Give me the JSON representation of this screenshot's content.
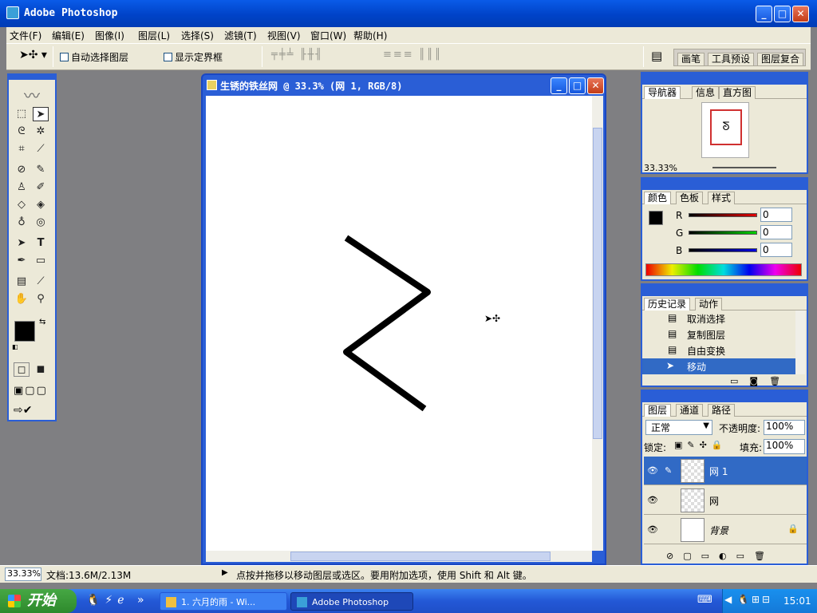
{
  "app": {
    "title": "Adobe Photoshop"
  },
  "menu": [
    "文件(F)",
    "编辑(E)",
    "图像(I)",
    "图层(L)",
    "选择(S)",
    "滤镜(T)",
    "视图(V)",
    "窗口(W)",
    "帮助(H)"
  ],
  "options": {
    "auto_select_layer": "自动选择图层",
    "show_bounding_box": "显示定界框",
    "palette_tabs": [
      "画笔",
      "工具预设",
      "图层复合"
    ]
  },
  "document": {
    "title": "生锈的铁丝网 @ 33.3% (网 1, RGB/8)"
  },
  "navigator": {
    "tabs": [
      "导航器",
      "信息",
      "直方图"
    ],
    "zoom": "33.33%"
  },
  "color": {
    "tabs": [
      "颜色",
      "色板",
      "样式"
    ],
    "channels": [
      {
        "label": "R",
        "value": "0"
      },
      {
        "label": "G",
        "value": "0"
      },
      {
        "label": "B",
        "value": "0"
      }
    ]
  },
  "history": {
    "tabs": [
      "历史记录",
      "动作"
    ],
    "items": [
      "取消选择",
      "复制图层",
      "自由变换",
      "移动"
    ]
  },
  "layers": {
    "tabs": [
      "图层",
      "通道",
      "路径"
    ],
    "blend_mode": "正常",
    "opacity_label": "不透明度:",
    "opacity": "100%",
    "lock_label": "锁定:",
    "fill_label": "填充:",
    "fill": "100%",
    "items": [
      "网 1",
      "网",
      "背景"
    ]
  },
  "status": {
    "zoom": "33.33%",
    "doc_info": "文档:13.6M/2.13M",
    "hint": "点按并拖移以移动图层或选区。要用附加选项，使用 Shift 和 Alt 键。"
  },
  "taskbar": {
    "start": "开始",
    "tasks": [
      "1. 六月的雨 - Wi...",
      "Adobe Photoshop"
    ],
    "clock": "15:01"
  }
}
